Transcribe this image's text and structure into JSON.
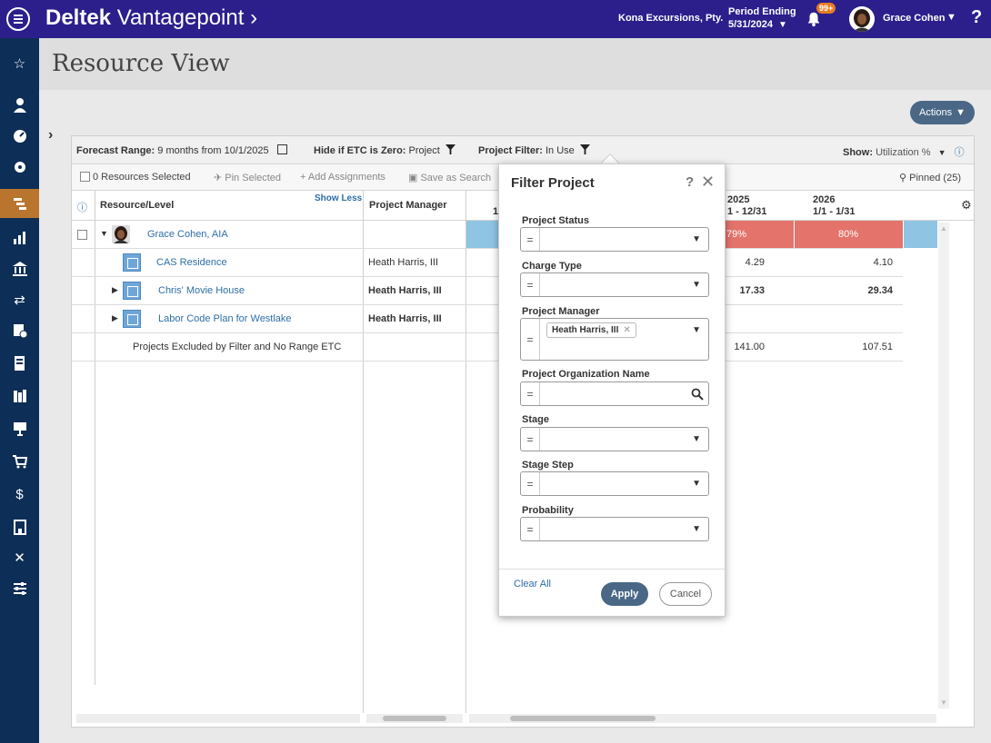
{
  "topbar": {
    "brand_bold": "Deltek",
    "brand_light": "Vantagepoint",
    "brand_arrow": "›",
    "company": "Kona Excursions, Pty.",
    "period_label": "Period Ending",
    "period_date": "5/31/2024",
    "notification_count": "99+",
    "username": "Grace Cohen",
    "help": "?"
  },
  "leftnav": {
    "icons": [
      "star-icon",
      "person-icon",
      "dashboard-icon",
      "hub-icon",
      "resource-view-icon",
      "chart-icon",
      "bank-icon",
      "transfer-icon",
      "timesheet-icon",
      "billing-icon",
      "library-icon",
      "presentation-icon",
      "cart-icon",
      "money-icon",
      "building-icon",
      "tools-icon",
      "settings-sliders-icon"
    ]
  },
  "page": {
    "title": "Resource View",
    "actions_label": "Actions"
  },
  "forecast": {
    "range_label": "Forecast Range:",
    "range_value": "9 months from 10/1/2025",
    "hide_label": "Hide if ETC is Zero:",
    "hide_value": "Project",
    "filter_label": "Project Filter:",
    "filter_value": "In Use",
    "show_label": "Show:",
    "show_value": "Utilization %"
  },
  "toolbar": {
    "selected": "0 Resources Selected",
    "pin": "Pin Selected",
    "add": "Add Assignments",
    "save": "Save as Search",
    "pinned": "Pinned (25)"
  },
  "grid": {
    "col_resource": "Resource/Level",
    "show_less": "Show Less",
    "col_pm": "Project Manager",
    "col_partial": "1",
    "period_2025_year": "2025",
    "period_2025_range": "1 - 12/31",
    "period_2026_year": "2026",
    "period_2026_range": "1/1 - 1/31",
    "rows": [
      {
        "name": "Grace Cohen, AIA",
        "pm": "",
        "v2025": "79%",
        "v2026": "80%"
      },
      {
        "name": "CAS Residence",
        "pm": "Heath Harris, III",
        "v2025": "4.29",
        "v2026": "4.10"
      },
      {
        "name": "Chris' Movie House",
        "pm": "Heath Harris, III",
        "v2025": "17.33",
        "v2026": "29.34"
      },
      {
        "name": "Labor Code Plan for Westlake",
        "pm": "Heath Harris, III",
        "v2025": "",
        "v2026": ""
      },
      {
        "name": "Projects Excluded by Filter and No Range ETC",
        "pm": "",
        "v2025": "141.00",
        "v2026": "107.51"
      }
    ],
    "colors": {
      "util_over": "#e4736b",
      "util_band": "#8fc4e3"
    }
  },
  "popup": {
    "title": "Filter Project",
    "help": "?",
    "close": "✕",
    "operator": "=",
    "fields": [
      {
        "label": "Project Status",
        "value": ""
      },
      {
        "label": "Charge Type",
        "value": ""
      },
      {
        "label": "Project Manager",
        "value": "Heath Harris, III"
      },
      {
        "label": "Project Organization Name",
        "value": ""
      },
      {
        "label": "Stage",
        "value": ""
      },
      {
        "label": "Stage Step",
        "value": ""
      },
      {
        "label": "Probability",
        "value": ""
      }
    ],
    "clear_all": "Clear All",
    "apply": "Apply",
    "cancel": "Cancel"
  }
}
